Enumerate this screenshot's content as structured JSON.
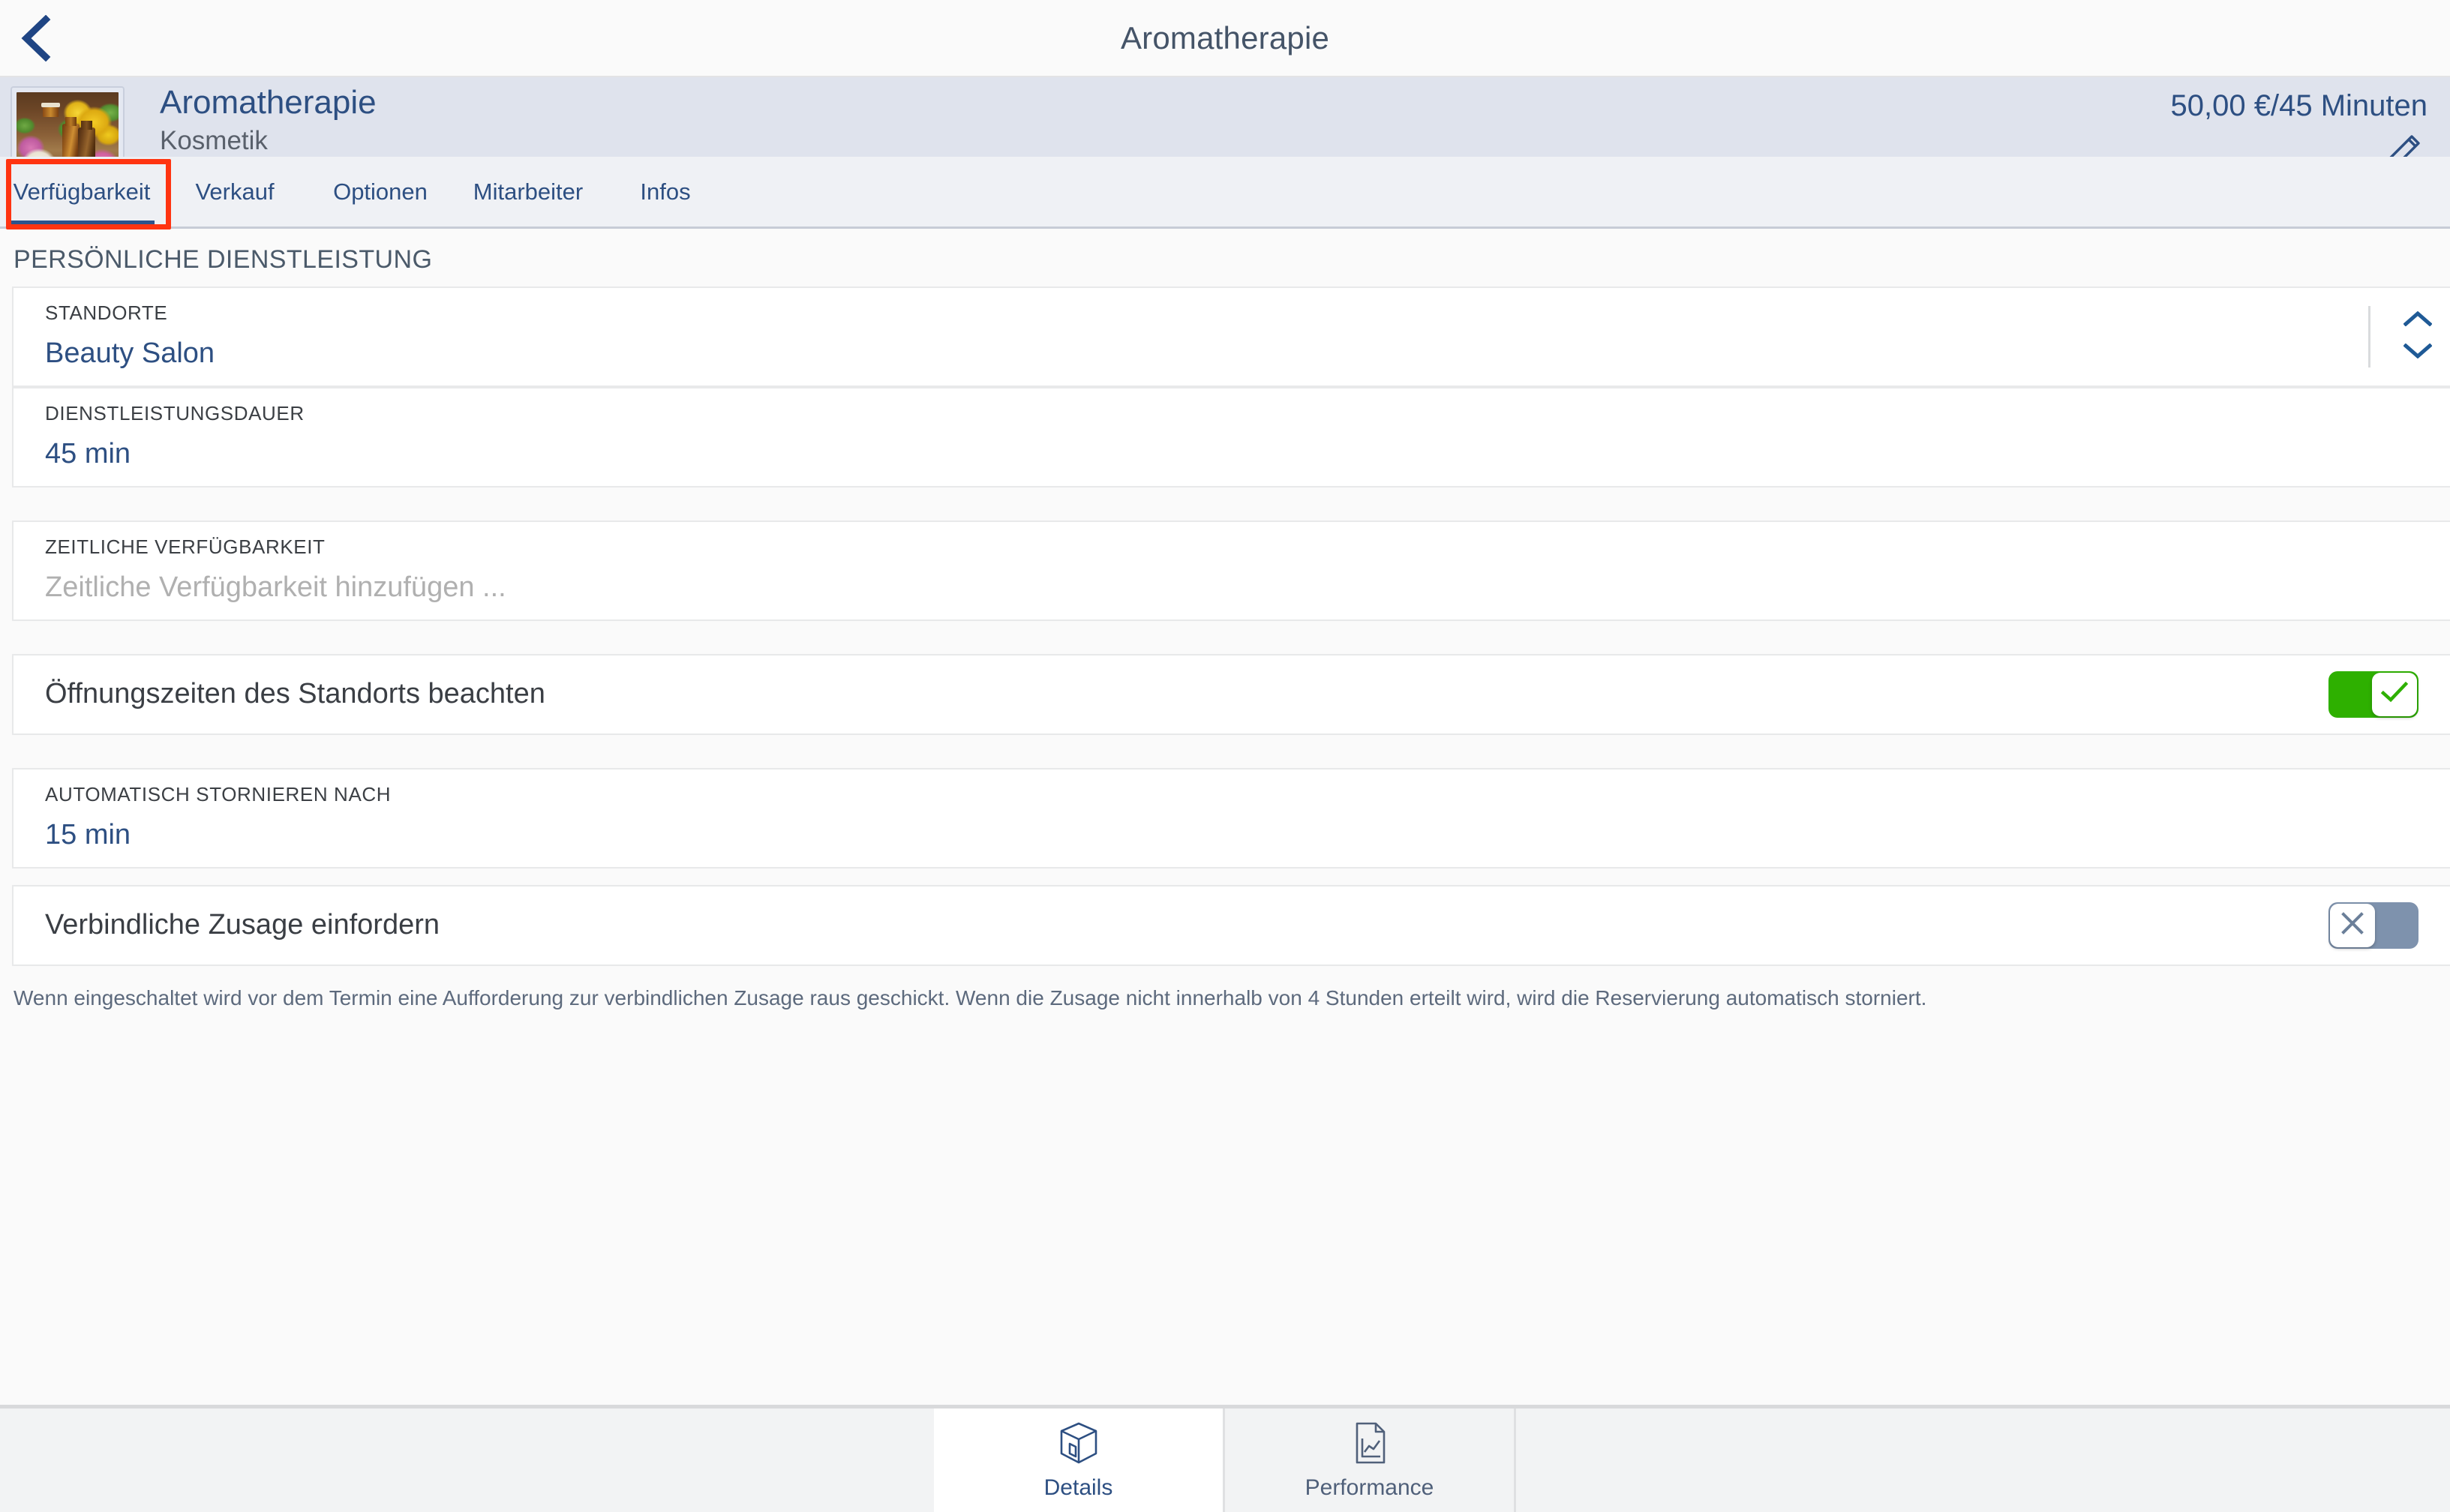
{
  "navbar": {
    "back_icon": "chevron-left-icon",
    "title": "Aromatherapie"
  },
  "service_header": {
    "thumbnail_alt": "aromatherapy-oil-bottles-photo",
    "title": "Aromatherapie",
    "category": "Kosmetik",
    "location": "Beauty Salon",
    "price": "50,00 €/45 Minuten",
    "edit_icon": "pencil-icon"
  },
  "tabs": [
    {
      "label": "Verfügbarkeit",
      "active": true
    },
    {
      "label": "Verkauf",
      "active": false
    },
    {
      "label": "Optionen",
      "active": false
    },
    {
      "label": "Mitarbeiter",
      "active": false
    },
    {
      "label": "Infos",
      "active": false
    }
  ],
  "content": {
    "section_title": "PERSÖNLICHE DIENSTLEISTUNG",
    "fields": {
      "standorte": {
        "label": "STANDORTE",
        "value": "Beauty Salon"
      },
      "dienstleistungsdauer": {
        "label": "DIENSTLEISTUNGSDAUER",
        "value": "45 min"
      },
      "zeitliche_verfuegbarkeit": {
        "label": "ZEITLICHE VERFÜGBARKEIT",
        "placeholder": "Zeitliche Verfügbarkeit hinzufügen ..."
      },
      "automatisch_stornieren": {
        "label": "AUTOMATISCH STORNIEREN NACH",
        "value": "15 min"
      }
    },
    "toggles": {
      "oeffnungszeiten": {
        "label": "Öffnungszeiten des Standorts beachten",
        "state": "on",
        "icon": "check-icon"
      },
      "verbindliche_zusage": {
        "label": "Verbindliche Zusage einfordern",
        "state": "off",
        "icon": "close-icon"
      }
    },
    "footnote": "Wenn eingeschaltet wird vor dem Termin eine Aufforderung zur verbindlichen Zusage raus geschickt. Wenn die Zusage nicht innerhalb von 4 Stunden erteilt wird, wird die Reservierung automatisch storniert."
  },
  "bottom_tabs": [
    {
      "label": "Details",
      "icon": "box-icon",
      "active": true
    },
    {
      "label": "Performance",
      "icon": "document-chart-icon",
      "active": false
    }
  ],
  "colors": {
    "accent_blue": "#2d4f82",
    "toggle_on": "#2eb000",
    "toggle_off": "#7e92ad",
    "highlight_red": "#ff3411",
    "header_bg": "#dfe3ed"
  }
}
